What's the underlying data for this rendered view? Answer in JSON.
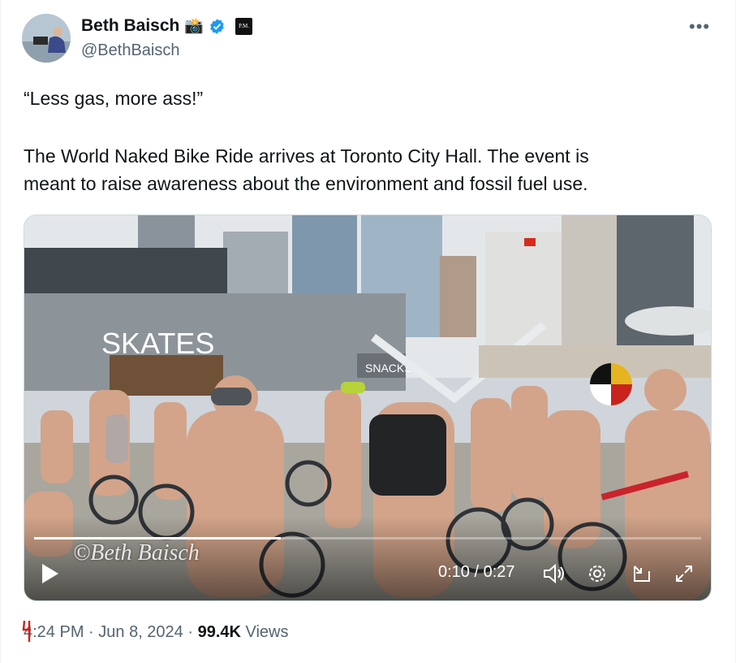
{
  "author": {
    "display_name": "Beth Baisch",
    "name_emoji": "📸",
    "affiliation_badge": "P.M.",
    "handle": "@BethBaisch"
  },
  "tweet": {
    "line1": "“Less gas, more ass!”",
    "line2": "The World Naked Bike Ride arrives at Toronto City Hall. The event is",
    "line3": "meant to raise awareness about the environment and fossil fuel use."
  },
  "video": {
    "sign_skates": "SKATES",
    "sign_snacks": "SNACKS",
    "watermark": "©Beth Baisch",
    "time_display": "0:10 / 0:27",
    "progress": 0.37
  },
  "footer": {
    "time": "4:24 PM",
    "sep1": " · ",
    "date": "Jun 8, 2024",
    "sep2": " · ",
    "views_count": "99.4K",
    "views_label": " Views"
  },
  "icons": {
    "more": "more-options-icon",
    "verified": "verified-badge-icon",
    "play": "play-icon",
    "volume": "volume-icon",
    "settings": "settings-icon",
    "pip": "picture-in-picture-icon",
    "fullscreen": "fullscreen-icon"
  },
  "colors": {
    "verified": "#1d9bf0",
    "secondary_text": "#536471",
    "primary_text": "#0f1419"
  }
}
